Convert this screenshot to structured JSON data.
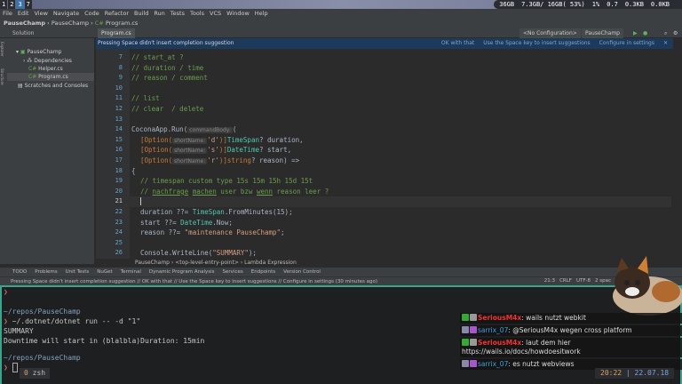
{
  "topbar": {
    "tags": [
      "1",
      "2",
      "3",
      "7"
    ],
    "stats": [
      "36GB",
      "7.3GB/ 16GB( 53%)",
      "1%",
      "0.7",
      "0.3KB",
      "0.0KB"
    ]
  },
  "menu": [
    "File",
    "Edit",
    "View",
    "Navigate",
    "Code",
    "Refactor",
    "Build",
    "Run",
    "Tests",
    "Tools",
    "VCS",
    "Window",
    "Help"
  ],
  "breadcrumb": [
    "PauseChamp",
    "PauseChamp",
    "Program.cs"
  ],
  "toolbar": {
    "solution": "Solution",
    "config": "<No Configuration>",
    "run_target": "PauseChamp",
    "tab": "Program.cs"
  },
  "notification": {
    "text": "Pressing Space didn't insert completion suggestion",
    "actions": [
      "OK with that",
      "Use the Space key to insert suggestions",
      "Configure in settings"
    ]
  },
  "tree": [
    "PauseChamp",
    "Dependencies",
    "Helper.cs",
    "Program.cs",
    "Scratches and Consoles"
  ],
  "side_labels": [
    "Explorer",
    "Structure"
  ],
  "code": {
    "line_numbers": [
      "7",
      "8",
      "9",
      "10",
      "11",
      "12",
      "13",
      "14",
      "15",
      "16",
      "17",
      "18",
      "19",
      "20",
      "21",
      "22",
      "23",
      "24",
      "25",
      "26"
    ],
    "l7": "// start_at ?",
    "l8": "// duration / time",
    "l9": "// reason / comment",
    "l11": "// list",
    "l12": "// clear  / delete",
    "l14a": "CoconaApp.Run(",
    "l14h": "commandBody:",
    "l14b": "(",
    "opt": "[Option(",
    "hint": "shortName:",
    "l15c": "'d'",
    "l15d": ")]",
    "l15t": "TimeSpan",
    "l15e": "? duration,",
    "l16c": "'s'",
    "l16t": "DateTime",
    "l16e": "? start,",
    "l17c": "'r'",
    "l17t": "string",
    "l17e": "? reason) =>",
    "l18": "{",
    "l19": "// timespan custom type 15s 15m 15h 15d 15t",
    "l20a": "// ",
    "l20b": "nachfrage",
    "l20c": " ",
    "l20d": "machen",
    "l20e": " user bzw ",
    "l20f": "wenn",
    "l20g": " reason leer ?",
    "l22a": "duration ??= ",
    "l22t": "TimeSpan",
    "l22b": ".FromMinutes(15);",
    "l23a": "start ??= ",
    "l23t": "DateTime",
    "l23b": ".Now;",
    "l24a": "reason ??= ",
    "l24s": "\"maintenance PauseChamp\"",
    "l24b": ";",
    "l26a": "Console.WriteLine(",
    "l26s": "\"SUMMARY\"",
    "l26b": ");"
  },
  "editor_breadcrumb": [
    "PauseChamp",
    "<top-level-entry-point>",
    "Lambda Expression"
  ],
  "tool_windows": [
    "TODO",
    "Problems",
    "Unit Tests",
    "NuGet",
    "Terminal",
    "Dynamic Program Analysis",
    "Services",
    "Endpoints",
    "Version Control"
  ],
  "status": {
    "message": "Pressing Space didn't insert completion suggestion // OK with that // Use the Space key to insert suggestions // Configure in settings (30 minutes ago)",
    "position": "21:3",
    "line_ending": "CRLF",
    "encoding": "UTF-8",
    "indent": "2 spac"
  },
  "terminal": {
    "prompt": "❯",
    "path": "~/repos/PauseChamp",
    "cmd": " ~/.dotnet/dotnet run -- -d \"1\"",
    "out1": "SUMMARY",
    "out2": "Downtime will start in (blalbla)Duration: 15min",
    "tab_index": "0",
    "tab_name": "zsh"
  },
  "chat": [
    {
      "user": "SeriousM4x",
      "text": ": wails nutzt webkit"
    },
    {
      "user": "sarrix_07",
      "text": ": @SeriousM4x wegen cross platform"
    },
    {
      "user": "SeriousM4x",
      "text": ": laut dem hier https://wails.io/docs/howdoesitwork"
    },
    {
      "user": "sarrix_07",
      "text": ": es nutzt webviews"
    }
  ],
  "clock": {
    "time": "20:22",
    "date": "22.07.18"
  }
}
